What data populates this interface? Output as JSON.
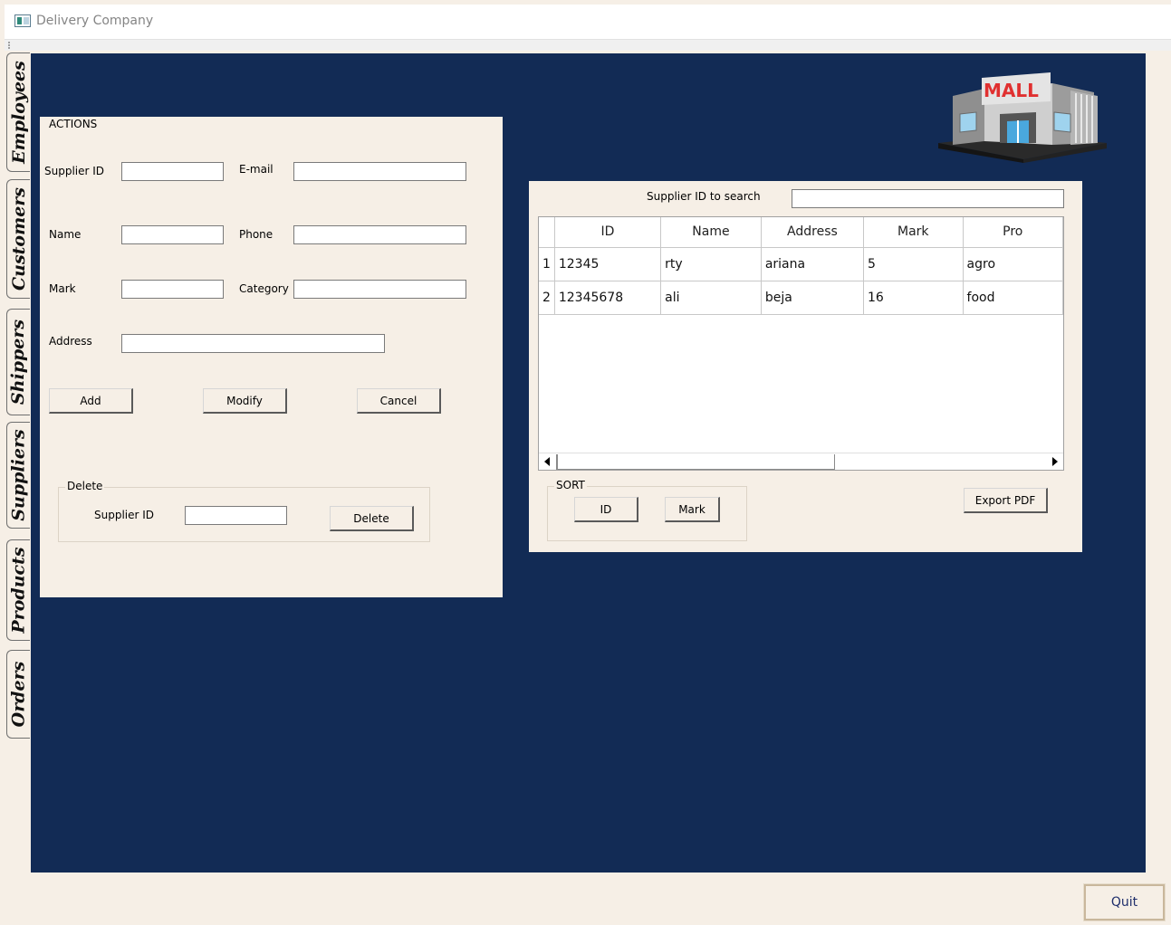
{
  "window": {
    "title": "Delivery Company"
  },
  "tabs": [
    {
      "label": "Employees"
    },
    {
      "label": "Customers"
    },
    {
      "label": "Shippers"
    },
    {
      "label": "Suppliers"
    },
    {
      "label": "Products"
    },
    {
      "label": "Orders"
    }
  ],
  "logo": {
    "text": "MALL",
    "icon": "mall-building-icon"
  },
  "actions": {
    "title": "ACTIONS",
    "supplier_id_label": "Supplier ID",
    "email_label": "E-mail",
    "name_label": "Name",
    "phone_label": "Phone",
    "mark_label": "Mark",
    "category_label": "Category",
    "address_label": "Address",
    "supplier_id_value": "",
    "email_value": "",
    "name_value": "",
    "phone_value": "",
    "mark_value": "",
    "category_value": "",
    "address_value": "",
    "add_label": "Add",
    "modify_label": "Modify",
    "cancel_label": "Cancel"
  },
  "delete_group": {
    "title": "Delete",
    "supplier_id_label": "Supplier ID",
    "supplier_id_value": "",
    "delete_label": "Delete"
  },
  "search": {
    "label": "Supplier ID to search",
    "value": ""
  },
  "table": {
    "columns": [
      "ID",
      "Name",
      "Address",
      "Mark",
      "Pro"
    ],
    "rows": [
      {
        "num": "1",
        "cells": [
          "12345",
          "rty",
          "ariana",
          "5",
          "agro"
        ]
      },
      {
        "num": "2",
        "cells": [
          "12345678",
          "ali",
          "beja",
          "16",
          "food"
        ]
      }
    ]
  },
  "sort": {
    "title": "SORT",
    "id_label": "ID",
    "mark_label": "Mark"
  },
  "export_label": "Export PDF",
  "quit_label": "Quit",
  "colors": {
    "content_bg": "#122b55",
    "panel_bg": "#f6efe6",
    "quit_text": "#1f2e6b"
  }
}
